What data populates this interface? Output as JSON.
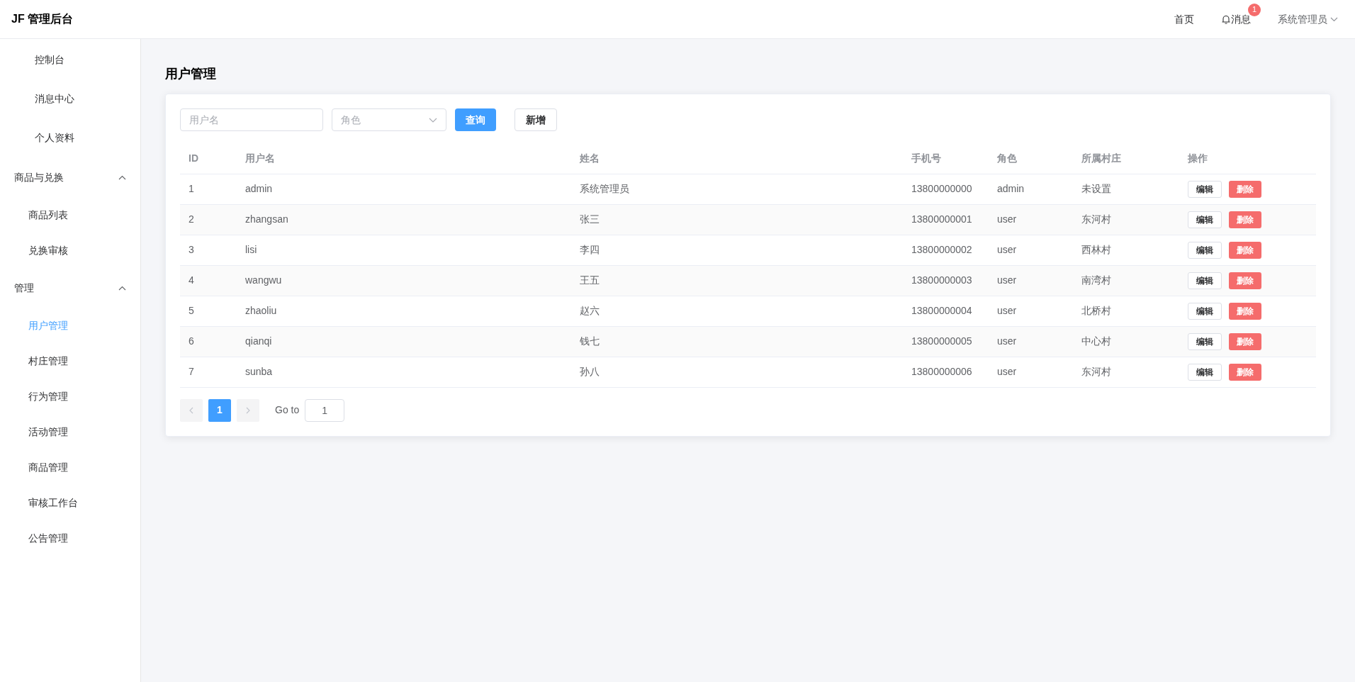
{
  "header": {
    "logo": "JF 管理后台",
    "nav": [
      {
        "label": "首页",
        "kind": "link"
      },
      {
        "label": "消息",
        "kind": "bell",
        "badge": "1"
      },
      {
        "label": "系统管理员",
        "kind": "dropdown"
      }
    ]
  },
  "sidebar": {
    "items": [
      {
        "label": "控制台",
        "kind": "item",
        "selected": false
      },
      {
        "label": "消息中心",
        "kind": "item",
        "selected": false
      },
      {
        "label": "个人资料",
        "kind": "item",
        "selected": false
      },
      {
        "label": "商品与兑换",
        "kind": "group",
        "expanded": true,
        "children": [
          {
            "label": "商品列表",
            "selected": false
          },
          {
            "label": "兑换审核",
            "selected": false
          }
        ]
      },
      {
        "label": "管理",
        "kind": "group",
        "expanded": true,
        "children": [
          {
            "label": "用户管理",
            "selected": true
          },
          {
            "label": "村庄管理",
            "selected": false
          },
          {
            "label": "行为管理",
            "selected": false
          },
          {
            "label": "活动管理",
            "selected": false
          },
          {
            "label": "商品管理",
            "selected": false
          },
          {
            "label": "审核工作台",
            "selected": false
          },
          {
            "label": "公告管理",
            "selected": false
          }
        ]
      }
    ]
  },
  "page_title": "用户管理",
  "filters": {
    "username": {
      "placeholder": "用户名"
    },
    "role": {
      "placeholder": "角色"
    },
    "search_button": "查询",
    "add_button": "新增"
  },
  "table": {
    "columns": [
      "ID",
      "用户名",
      "姓名",
      "手机号",
      "角色",
      "所属村庄",
      "操作"
    ],
    "rows": [
      {
        "cells": [
          "1",
          "admin",
          "系统管理员",
          "13800000000",
          "admin",
          "未设置"
        ],
        "actions": [
          "编辑",
          "删除"
        ]
      },
      {
        "cells": [
          "2",
          "zhangsan",
          "张三",
          "13800000001",
          "user",
          "东河村"
        ],
        "actions": [
          "编辑",
          "删除"
        ]
      },
      {
        "cells": [
          "3",
          "lisi",
          "李四",
          "13800000002",
          "user",
          "西林村"
        ],
        "actions": [
          "编辑",
          "删除"
        ]
      },
      {
        "cells": [
          "4",
          "wangwu",
          "王五",
          "13800000003",
          "user",
          "南湾村"
        ],
        "actions": [
          "编辑",
          "删除"
        ]
      },
      {
        "cells": [
          "5",
          "zhaoliu",
          "赵六",
          "13800000004",
          "user",
          "北桥村"
        ],
        "actions": [
          "编辑",
          "删除"
        ]
      },
      {
        "cells": [
          "6",
          "qianqi",
          "钱七",
          "13800000005",
          "user",
          "中心村"
        ],
        "actions": [
          "编辑",
          "删除"
        ]
      },
      {
        "cells": [
          "7",
          "sunba",
          "孙八",
          "13800000006",
          "user",
          "东河村"
        ],
        "actions": [
          "编辑",
          "删除"
        ]
      }
    ]
  },
  "pagination": {
    "pages": [
      {
        "label": "1",
        "selected": true
      }
    ],
    "prev_disabled": true,
    "next_disabled": true,
    "goto_label": "Go to",
    "goto_value": "1"
  }
}
